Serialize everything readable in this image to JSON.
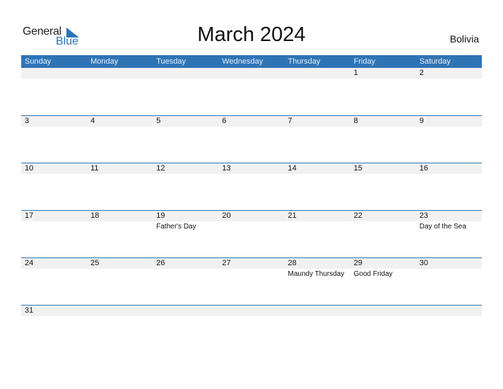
{
  "brand": {
    "general": "General",
    "blue": "Blue",
    "icon": "triangle-logo-icon",
    "color": "#2e74b5"
  },
  "title": "March 2024",
  "country": "Bolivia",
  "weekdays": [
    "Sunday",
    "Monday",
    "Tuesday",
    "Wednesday",
    "Thursday",
    "Friday",
    "Saturday"
  ],
  "weeks": [
    [
      {
        "day": "",
        "event": ""
      },
      {
        "day": "",
        "event": ""
      },
      {
        "day": "",
        "event": ""
      },
      {
        "day": "",
        "event": ""
      },
      {
        "day": "",
        "event": ""
      },
      {
        "day": "1",
        "event": ""
      },
      {
        "day": "2",
        "event": ""
      }
    ],
    [
      {
        "day": "3",
        "event": ""
      },
      {
        "day": "4",
        "event": ""
      },
      {
        "day": "5",
        "event": ""
      },
      {
        "day": "6",
        "event": ""
      },
      {
        "day": "7",
        "event": ""
      },
      {
        "day": "8",
        "event": ""
      },
      {
        "day": "9",
        "event": ""
      }
    ],
    [
      {
        "day": "10",
        "event": ""
      },
      {
        "day": "11",
        "event": ""
      },
      {
        "day": "12",
        "event": ""
      },
      {
        "day": "13",
        "event": ""
      },
      {
        "day": "14",
        "event": ""
      },
      {
        "day": "15",
        "event": ""
      },
      {
        "day": "16",
        "event": ""
      }
    ],
    [
      {
        "day": "17",
        "event": ""
      },
      {
        "day": "18",
        "event": ""
      },
      {
        "day": "19",
        "event": "Father's Day"
      },
      {
        "day": "20",
        "event": ""
      },
      {
        "day": "21",
        "event": ""
      },
      {
        "day": "22",
        "event": ""
      },
      {
        "day": "23",
        "event": "Day of the Sea"
      }
    ],
    [
      {
        "day": "24",
        "event": ""
      },
      {
        "day": "25",
        "event": ""
      },
      {
        "day": "26",
        "event": ""
      },
      {
        "day": "27",
        "event": ""
      },
      {
        "day": "28",
        "event": "Maundy Thursday"
      },
      {
        "day": "29",
        "event": "Good Friday"
      },
      {
        "day": "30",
        "event": ""
      }
    ],
    [
      {
        "day": "31",
        "event": ""
      },
      {
        "day": "",
        "event": ""
      },
      {
        "day": "",
        "event": ""
      },
      {
        "day": "",
        "event": ""
      },
      {
        "day": "",
        "event": ""
      },
      {
        "day": "",
        "event": ""
      },
      {
        "day": "",
        "event": ""
      }
    ]
  ]
}
